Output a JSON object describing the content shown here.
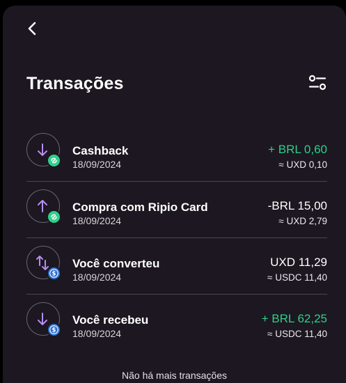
{
  "header": {
    "back_icon": "chevron-left-icon",
    "title": "Transações",
    "filter_icon": "filter-sliders-icon"
  },
  "colors": {
    "background": "#1c1720",
    "positive": "#2fd08a",
    "arrow": "#b68ef0",
    "usdc": "#2b6fd1"
  },
  "transactions": [
    {
      "name": "Cashback",
      "date": "18/09/2024",
      "amount": "+ BRL 0,60",
      "secondary": "≈ UXD 0,10",
      "direction": "down",
      "badge": "ripio-icon",
      "positive": true
    },
    {
      "name": "Compra com Ripio Card",
      "date": "18/09/2024",
      "amount": "-BRL 15,00",
      "secondary": "≈ UXD 2,79",
      "direction": "up",
      "badge": "ripio-icon",
      "positive": false
    },
    {
      "name": "Você converteu",
      "date": "18/09/2024",
      "amount": "UXD 11,29",
      "secondary": "≈ USDC 11,40",
      "direction": "convert",
      "badge": "usdc-icon",
      "positive": false
    },
    {
      "name": "Você recebeu",
      "date": "18/09/2024",
      "amount": "+ BRL 62,25",
      "secondary": "≈ USDC 11,40",
      "direction": "down",
      "badge": "usdc-icon",
      "positive": true
    }
  ],
  "footer": "Não há mais transações"
}
